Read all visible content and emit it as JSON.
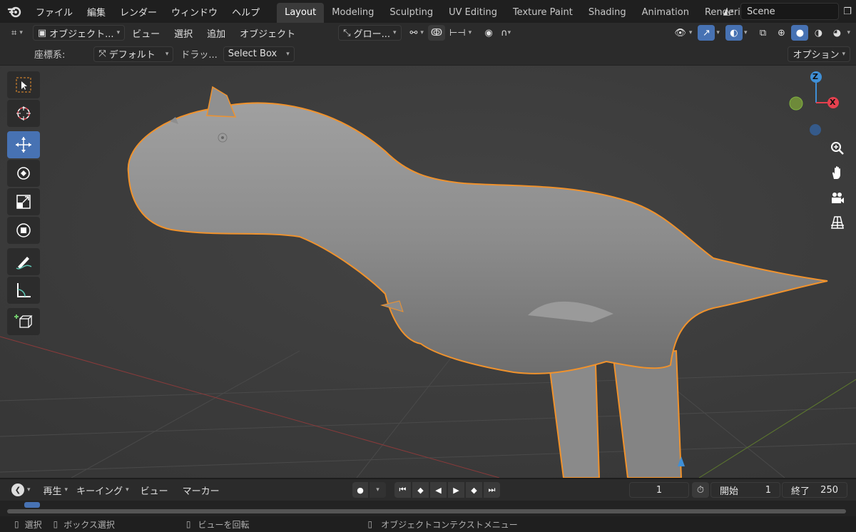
{
  "menu": [
    "ファイル",
    "編集",
    "レンダー",
    "ウィンドウ",
    "ヘルプ"
  ],
  "workspaces": [
    "Layout",
    "Modeling",
    "Sculpting",
    "UV Editing",
    "Texture Paint",
    "Shading",
    "Animation",
    "Rendering"
  ],
  "scene": {
    "label": "Scene"
  },
  "header": {
    "mode": "オブジェクト...",
    "view": "ビュー",
    "select": "選択",
    "add": "追加",
    "object": "オブジェクト",
    "transform": "グロー..."
  },
  "toolsettings": {
    "orient_label": "座標系:",
    "orient_value": "デフォルト",
    "drag_label": "ドラッ...",
    "drag_value": "Select Box",
    "options": "オプション"
  },
  "gizmo": {
    "z": "Z",
    "x": "X"
  },
  "timeline": {
    "play": "再生",
    "keying": "キーイング",
    "view": "ビュー",
    "marker": "マーカー",
    "current": "1",
    "start_label": "開始",
    "start": "1",
    "end_label": "終了",
    "end": "250"
  },
  "status": {
    "select": "選択",
    "box_select": "ボックス選択",
    "rotate": "ビューを回転",
    "context": "オブジェクトコンテクストメニュー"
  },
  "colors": {
    "accent": "#4772b3",
    "selection_outline": "#f0922c",
    "axis_x": "#e5404e",
    "axis_y": "#80b340",
    "axis_z": "#3f8fd6"
  }
}
